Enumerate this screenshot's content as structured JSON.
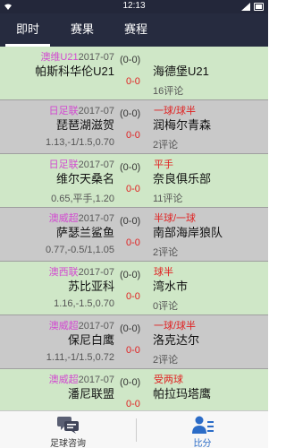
{
  "status": {
    "time": "12:13"
  },
  "tabs": [
    {
      "label": "即时",
      "active": true
    },
    {
      "label": "赛果",
      "active": false
    },
    {
      "label": "赛程",
      "active": false
    }
  ],
  "matches": [
    {
      "league": "澳维U21",
      "date": "2017-07",
      "home": "帕斯科华伦U21",
      "odds": "",
      "half": "(0-0)",
      "score": "0-0",
      "tag": "",
      "away": "海德堡U21",
      "comments": "16评论",
      "bg": "green"
    },
    {
      "league": "日足联",
      "date": "2017-07",
      "home": "琵琶湖滋贺",
      "odds": "1.13,-1/1.5,0.70",
      "half": "(0-0)",
      "score": "0-0",
      "tag": "一球/球半",
      "away": "润梅尔青森",
      "comments": "2评论",
      "bg": "gray"
    },
    {
      "league": "日足联",
      "date": "2017-07",
      "home": "维尔天桑名",
      "odds": "0.65,平手,1.20",
      "half": "(0-0)",
      "score": "0-0",
      "tag": "平手",
      "away": "奈良俱乐部",
      "comments": "11评论",
      "bg": "green"
    },
    {
      "league": "澳威超",
      "date": "2017-07",
      "home": "萨瑟兰鲨鱼",
      "odds": "0.77,-0.5/1,1.05",
      "half": "(0-0)",
      "score": "0-0",
      "tag": "半球/一球",
      "away": "南部海岸狼队",
      "comments": "2评论",
      "bg": "gray"
    },
    {
      "league": "澳西联",
      "date": "2017-07",
      "home": "苏比亚科",
      "odds": "1.16,-1.5,0.70",
      "half": "(0-0)",
      "score": "0-0",
      "tag": "球半",
      "away": "湾水市",
      "comments": "0评论",
      "bg": "green"
    },
    {
      "league": "澳威超",
      "date": "2017-07",
      "home": "保尼白鹰",
      "odds": "1.11,-1/1.5,0.72",
      "half": "(0-0)",
      "score": "0-0",
      "tag": "一球/球半",
      "away": "洛克达尔",
      "comments": "2评论",
      "bg": "gray"
    },
    {
      "league": "澳威超",
      "date": "2017-07",
      "home": "潘尼联盟",
      "odds": "",
      "half": "(0-0)",
      "score": "0-0",
      "tag": "受两球",
      "away": "帕拉玛塔鹰",
      "comments": "",
      "bg": "green"
    }
  ],
  "bottom_nav": [
    {
      "label": "足球咨询",
      "icon": "chat-bubbles-icon",
      "active": false
    },
    {
      "label": "比分",
      "icon": "person-list-icon",
      "active": true
    }
  ],
  "colors": {
    "tabbar": "#262b3f",
    "row_green": "#cfe7c7",
    "row_gray": "#c9c9c9",
    "league": "#d24bd0",
    "accent_red": "#e02222",
    "active_blue": "#2b6cc7"
  }
}
